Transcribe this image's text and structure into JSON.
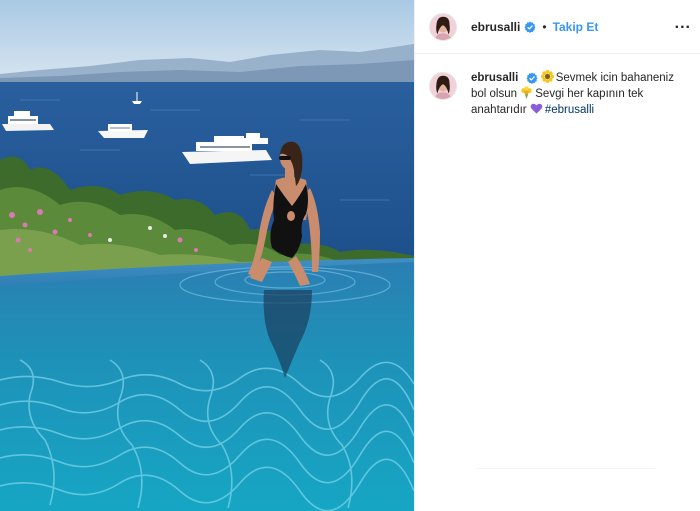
{
  "post": {
    "username": "ebrusalli",
    "follow_label": "Takip Et",
    "separator": "•",
    "more_label": "...",
    "caption": {
      "username": "ebrusalli",
      "part1": "Sevmek icin bahaneniz bol olsun",
      "part2": "Sevgi her kapının tek anahtarıdır",
      "hashtag": "#ebrusalli"
    },
    "icons": {
      "verified": "verified-badge-icon",
      "emoji1": "sun-flower-emoji",
      "emoji2": "flower-bouquet-emoji",
      "emoji3": "purple-heart-emoji"
    },
    "colors": {
      "link_blue": "#3897f0",
      "hashtag": "#003569",
      "text": "#262626",
      "heart": "#8a5cd6"
    }
  }
}
